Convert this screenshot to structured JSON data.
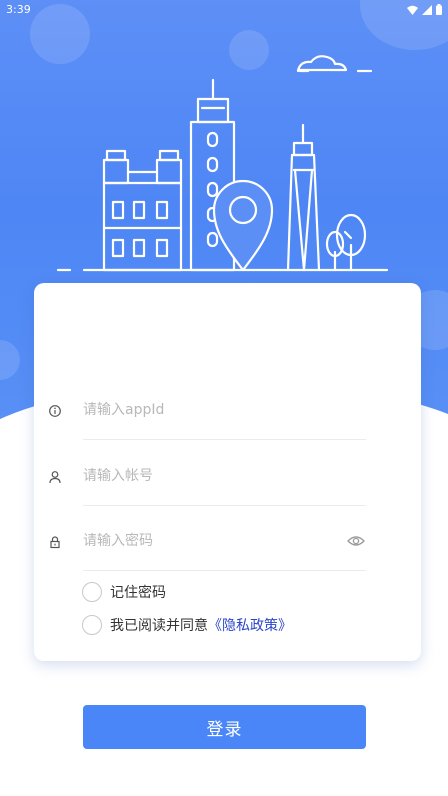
{
  "status_bar": {
    "time": "3:39",
    "icons": [
      "wifi-icon",
      "signal-icon",
      "battery-icon"
    ]
  },
  "form": {
    "appid": {
      "placeholder": "请输入appId",
      "icon": "info-circle-icon"
    },
    "account": {
      "placeholder": "请输入帐号",
      "icon": "user-icon"
    },
    "password": {
      "placeholder": "请输入密码",
      "icon": "lock-icon",
      "toggle_icon": "eye-icon"
    },
    "remember_label": "记住密码",
    "agree_prefix": "我已阅读并同意",
    "policy_link": "《隐私政策》",
    "login_label": "登录"
  },
  "colors": {
    "primary": "#4a86f7",
    "header_blue": "#5d8ff6",
    "link": "#2a46c8"
  }
}
